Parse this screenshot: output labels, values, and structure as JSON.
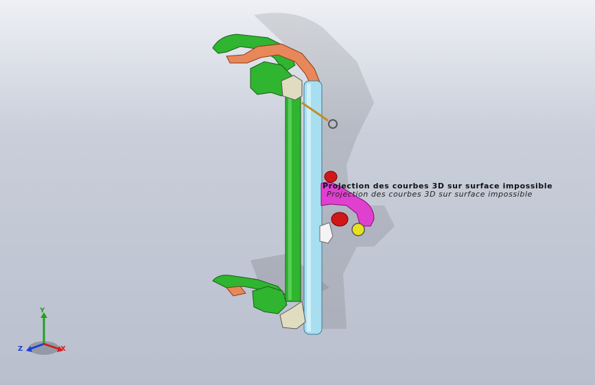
{
  "viewport": {
    "background_top": "#eef0f5",
    "background_bottom": "#b9bfcd"
  },
  "warnings": [
    "Projection des courbes 3D sur surface impossible",
    "Projection des courbes 3D sur surface impossible"
  ],
  "triad": {
    "x_label": "X",
    "y_label": "Y",
    "z_label": "Z",
    "x_color": "#d02020",
    "y_color": "#20a020",
    "z_color": "#2040d0"
  },
  "model_colors": {
    "frame": "#2fb52f",
    "handle": "#e8875a",
    "beam": "#a8dff0",
    "plate": "#e0dcc0",
    "hose": "#e040d0",
    "nozzle": "#d01818",
    "coupler": "#e8e020"
  }
}
